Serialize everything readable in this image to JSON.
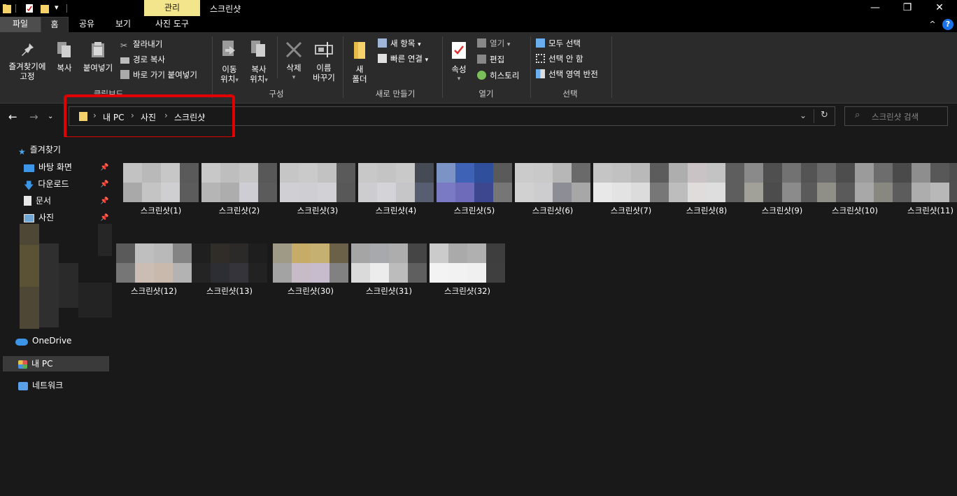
{
  "titlebar": {
    "context_tab": "관리",
    "window_title": "스크린샷",
    "minimize": "—",
    "maximize": "❐",
    "close": "✕"
  },
  "tabs": {
    "file": "파일",
    "home": "홈",
    "share": "공유",
    "view": "보기",
    "picture_tools": "사진 도구",
    "collapse": "^",
    "help": "?"
  },
  "ribbon": {
    "clipboard": {
      "label": "클립보드",
      "pin": "즐겨찾기에",
      "pin2": "고정",
      "copy": "복사",
      "paste": "붙여넣기",
      "cut": "잘라내기",
      "copy_path": "경로 복사",
      "paste_shortcut": "바로 가기 붙여넣기"
    },
    "organize": {
      "label": "구성",
      "move_to": "이동",
      "move_to2": "위치",
      "copy_to": "복사",
      "copy_to2": "위치",
      "delete": "삭제",
      "rename": "이름",
      "rename2": "바꾸기"
    },
    "new": {
      "label": "새로 만들기",
      "new_folder": "새",
      "new_folder2": "폴더",
      "new_item": "새 항목",
      "easy_access": "빠른 연결"
    },
    "open": {
      "label": "열기",
      "properties": "속성",
      "open": "열기",
      "edit": "편집",
      "history": "히스토리"
    },
    "select": {
      "label": "선택",
      "select_all": "모두 선택",
      "select_none": "선택 안 함",
      "invert": "선택 영역 반전"
    }
  },
  "address": {
    "crumbs": [
      "내 PC",
      "사진",
      "스크린샷"
    ],
    "search_placeholder": "스크린샷 검색"
  },
  "sidebar": {
    "quick_access": "즐겨찾기",
    "items": [
      "바탕 화면",
      "다운로드",
      "문서",
      "사진"
    ],
    "onedrive": "OneDrive",
    "this_pc": "내 PC",
    "network": "네트워크"
  },
  "files": [
    {
      "name": "스크린샷(1)",
      "colors": [
        "#c2c2c2",
        "#b9b9b9",
        "#c7c7c7",
        "#5a5a5a",
        "#a9a9a9",
        "#c4c4c4",
        "#cfcfd2",
        "#5c5c5c"
      ]
    },
    {
      "name": "스크린샷(2)",
      "colors": [
        "#c8c8c8",
        "#bebebe",
        "#c5c5c5",
        "#585858",
        "#b5b5b5",
        "#adadad",
        "#cdcdd3",
        "#5b5b5b"
      ]
    },
    {
      "name": "스크린샷(3)",
      "colors": [
        "#c6c6c6",
        "#cacaca",
        "#c2c2c2",
        "#5a5a5a",
        "#d0d0d4",
        "#cfcfd3",
        "#d2d2d6",
        "#585858"
      ]
    },
    {
      "name": "스크린샷(4)",
      "colors": [
        "#c8c8c8",
        "#c4c4c4",
        "#c9c9c9",
        "#464a55",
        "#cdcdcf",
        "#d3d3d8",
        "#c6c6c8",
        "#585e72"
      ]
    },
    {
      "name": "스크린샷(5)",
      "colors": [
        "#7b93c5",
        "#3e62b5",
        "#2f4e9c",
        "#5a5a5a",
        "#7a79c4",
        "#6e6bbb",
        "#3d478f",
        "#767676"
      ]
    },
    {
      "name": "스크린샷(6)",
      "colors": [
        "#cbcbcb",
        "#c9c9c9",
        "#b7b7b7",
        "#6a6a6a",
        "#d1d1d1",
        "#cdcdd0",
        "#8d8d95",
        "#a7a7a7"
      ]
    },
    {
      "name": "스크린샷(7)",
      "colors": [
        "#c5c5c5",
        "#c1c1c1",
        "#b9b9b9",
        "#5c5c5c",
        "#e8e8e8",
        "#e3e3e3",
        "#dcdcdc",
        "#777777"
      ]
    },
    {
      "name": "스크린샷(8)",
      "colors": [
        "#aeaeae",
        "#c9c3c5",
        "#c3c3c3",
        "#5e5e5e",
        "#bdbdbd",
        "#e0dcdc",
        "#dedede",
        "#5e5e5e"
      ]
    },
    {
      "name": "스크린샷(9)",
      "colors": [
        "#8a8a8a",
        "#4f4f4f",
        "#727272",
        "#545454",
        "#a1a19a",
        "#4c4c4c",
        "#8b8b8b",
        "#5a5a5a"
      ]
    },
    {
      "name": "스크린샷(10)",
      "colors": [
        "#6a6a6a",
        "#4d4d4d",
        "#9b9b9b",
        "#6d6d6d",
        "#8f8f88",
        "#5a5a5a",
        "#a8a8a8",
        "#888880"
      ]
    },
    {
      "name": "스크린샷(11)",
      "colors": [
        "#4a4a4a",
        "#8e8e8e",
        "#585858",
        "#4e4e4e",
        "#5c5c5c",
        "#adadad",
        "#b8b8b8",
        "#4f4f4f"
      ]
    },
    {
      "name": "스크린샷(12)",
      "colors": [
        "#5a5a5a",
        "#bfbfbf",
        "#b9b9b9",
        "#848484",
        "#767676",
        "#cbbcb4",
        "#c9b9ac",
        "#b3b3b3"
      ]
    },
    {
      "name": "스크린샷(13)",
      "colors": [
        "#1f1f1f",
        "#302c28",
        "#2c2a28",
        "#1e1e1e",
        "#242424",
        "#2d2e34",
        "#34343a",
        "#222222"
      ]
    },
    {
      "name": "스크린샷(30)",
      "colors": [
        "#9e9a85",
        "#c6ac67",
        "#c5b071",
        "#6a6148",
        "#a3a3a3",
        "#c8bbc8",
        "#c6bcce",
        "#818181"
      ]
    },
    {
      "name": "스크린샷(31)",
      "colors": [
        "#a5a5a5",
        "#a7a9ad",
        "#adadad",
        "#454545",
        "#dadada",
        "#ececec",
        "#bcbcbc",
        "#5f5f5f"
      ]
    },
    {
      "name": "스크린샷(32)",
      "colors": [
        "#cbcbcb",
        "#aaaaaa",
        "#b0b0b0",
        "#3e3e3e",
        "#f3f3f3",
        "#f2f2f2",
        "#f0f0f0",
        "#3f3f3f"
      ]
    }
  ]
}
